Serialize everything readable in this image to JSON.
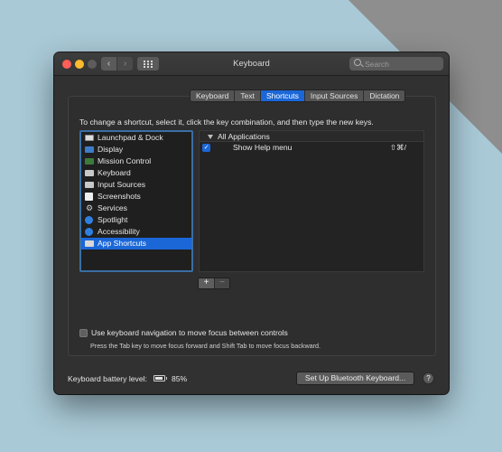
{
  "window": {
    "title": "Keyboard"
  },
  "toolbar": {
    "back_glyph": "‹",
    "forward_glyph": "›",
    "search_placeholder": "Search"
  },
  "tabs": [
    {
      "label": "Keyboard",
      "active": false
    },
    {
      "label": "Text",
      "active": false
    },
    {
      "label": "Shortcuts",
      "active": true
    },
    {
      "label": "Input Sources",
      "active": false
    },
    {
      "label": "Dictation",
      "active": false
    }
  ],
  "instructions": "To change a shortcut, select it, click the key combination, and then type the new keys.",
  "categories": [
    {
      "label": "Launchpad & Dock",
      "icon": "launchpad-icon"
    },
    {
      "label": "Display",
      "icon": "display-icon"
    },
    {
      "label": "Mission Control",
      "icon": "mission-control-icon"
    },
    {
      "label": "Keyboard",
      "icon": "keyboard-icon"
    },
    {
      "label": "Input Sources",
      "icon": "input-sources-icon"
    },
    {
      "label": "Screenshots",
      "icon": "screenshots-icon"
    },
    {
      "label": "Services",
      "icon": "gear-icon"
    },
    {
      "label": "Spotlight",
      "icon": "spotlight-icon"
    },
    {
      "label": "Accessibility",
      "icon": "accessibility-icon"
    },
    {
      "label": "App Shortcuts",
      "icon": "app-shortcuts-icon",
      "selected": true
    }
  ],
  "shortcuts": {
    "group": "All Applications",
    "rows": [
      {
        "label": "Show Help menu",
        "keys": "⇧⌘/",
        "checked": true
      }
    ]
  },
  "buttons": {
    "add": "+",
    "remove": "−",
    "bluetooth": "Set Up Bluetooth Keyboard...",
    "help": "?"
  },
  "navigation": {
    "checkbox_label": "Use keyboard navigation to move focus between controls",
    "checked": false,
    "hint": "Press the Tab key to move focus forward and Shift Tab to move focus backward."
  },
  "battery": {
    "label": "Keyboard battery level:",
    "percent": "85%",
    "level": 0.85
  }
}
